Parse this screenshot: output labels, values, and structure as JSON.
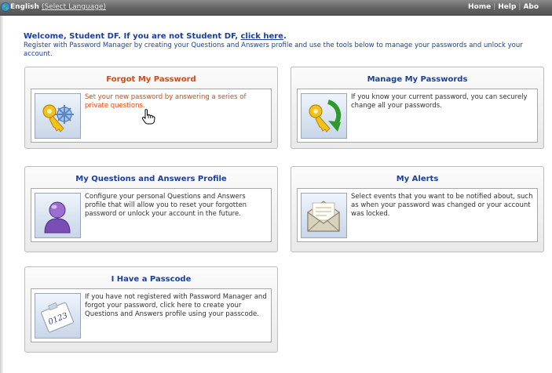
{
  "topbar": {
    "language": "English",
    "select_language": "(Select Language)",
    "links": [
      "Home",
      "Help",
      "Abo"
    ]
  },
  "welcome": {
    "text": "Welcome, Student DF. If you are not Student DF,",
    "link": "click here",
    "period": ".",
    "intro": "Register with Password Manager by creating your Questions and Answers profile and use the tools below to manage your passwords and unlock your account."
  },
  "cards": [
    {
      "title": "Forgot My Password",
      "desc": "Set your new password by answering a series of private questions.",
      "icon": "keys-icon"
    },
    {
      "title": "Manage My Passwords",
      "desc": "If you know your current password, you can securely change all your passwords.",
      "icon": "key-refresh-icon"
    },
    {
      "title": "My Questions and Answers Profile",
      "desc": "Configure your personal Questions and Answers profile that will allow you to reset your forgotten password or unlock your account in the future.",
      "icon": "user-profile-icon"
    },
    {
      "title": "My Alerts",
      "desc": "Select events that you want to be notified about, such as when your password was changed or your account was locked.",
      "icon": "envelope-icon"
    },
    {
      "title": "I Have a Passcode",
      "desc": "If you have not registered with Password Manager and forgot your password, click here to create your Questions and Answers profile using your passcode.",
      "icon": "passcode-note-icon",
      "note_text": "0123"
    }
  ],
  "colors": {
    "accent_blue": "#1b3f9b",
    "accent_orange": "#e1450e",
    "topbar_gray": "#6a6a6a"
  }
}
